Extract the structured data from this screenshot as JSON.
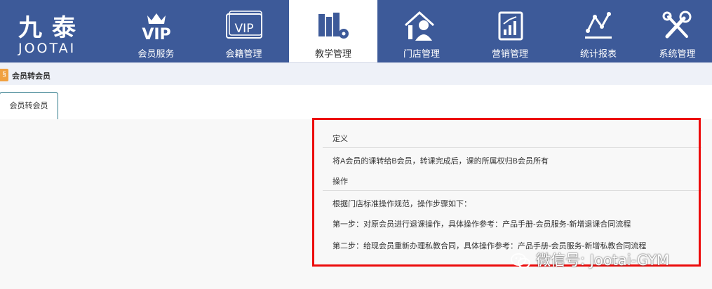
{
  "logo": {
    "cn": "九泰",
    "en": "JOOTAI"
  },
  "nav": [
    {
      "label": "会员服务",
      "icon": "vip-crown-icon"
    },
    {
      "label": "会籍管理",
      "icon": "vip-card-icon"
    },
    {
      "label": "教学管理",
      "icon": "books-gear-icon",
      "active": true
    },
    {
      "label": "门店管理",
      "icon": "house-person-icon"
    },
    {
      "label": "营销管理",
      "icon": "chart-report-icon"
    },
    {
      "label": "统计报表",
      "icon": "line-stats-icon"
    },
    {
      "label": "系统管理",
      "icon": "tools-icon"
    }
  ],
  "breadcrumb": {
    "icon": "breadcrumb-icon",
    "text": "会员转会员"
  },
  "tabs": [
    {
      "label": "会员转会员"
    }
  ],
  "panel": {
    "definition_heading": "定义",
    "definition_text": "将A会员的课转给B会员，转课完成后，课的所属权归B会员所有",
    "operation_heading": "操作",
    "operation_intro": "根据门店标准操作规范，操作步骤如下：",
    "step1": "第一步：对原会员进行退课操作，具体操作参考：产品手册-会员服务-新增退课合同流程",
    "step2": "第二步：给现会员重新办理私教合同，具体操作参考：产品手册-会员服务-新增私教合同流程"
  },
  "watermark": {
    "text": "微信号: Jootai-GYM",
    "icon": "wechat-icon"
  },
  "colors": {
    "nav_bg": "#3d5a99",
    "highlight_border": "#ec0b0b",
    "tab_border": "#2f7a8a"
  }
}
